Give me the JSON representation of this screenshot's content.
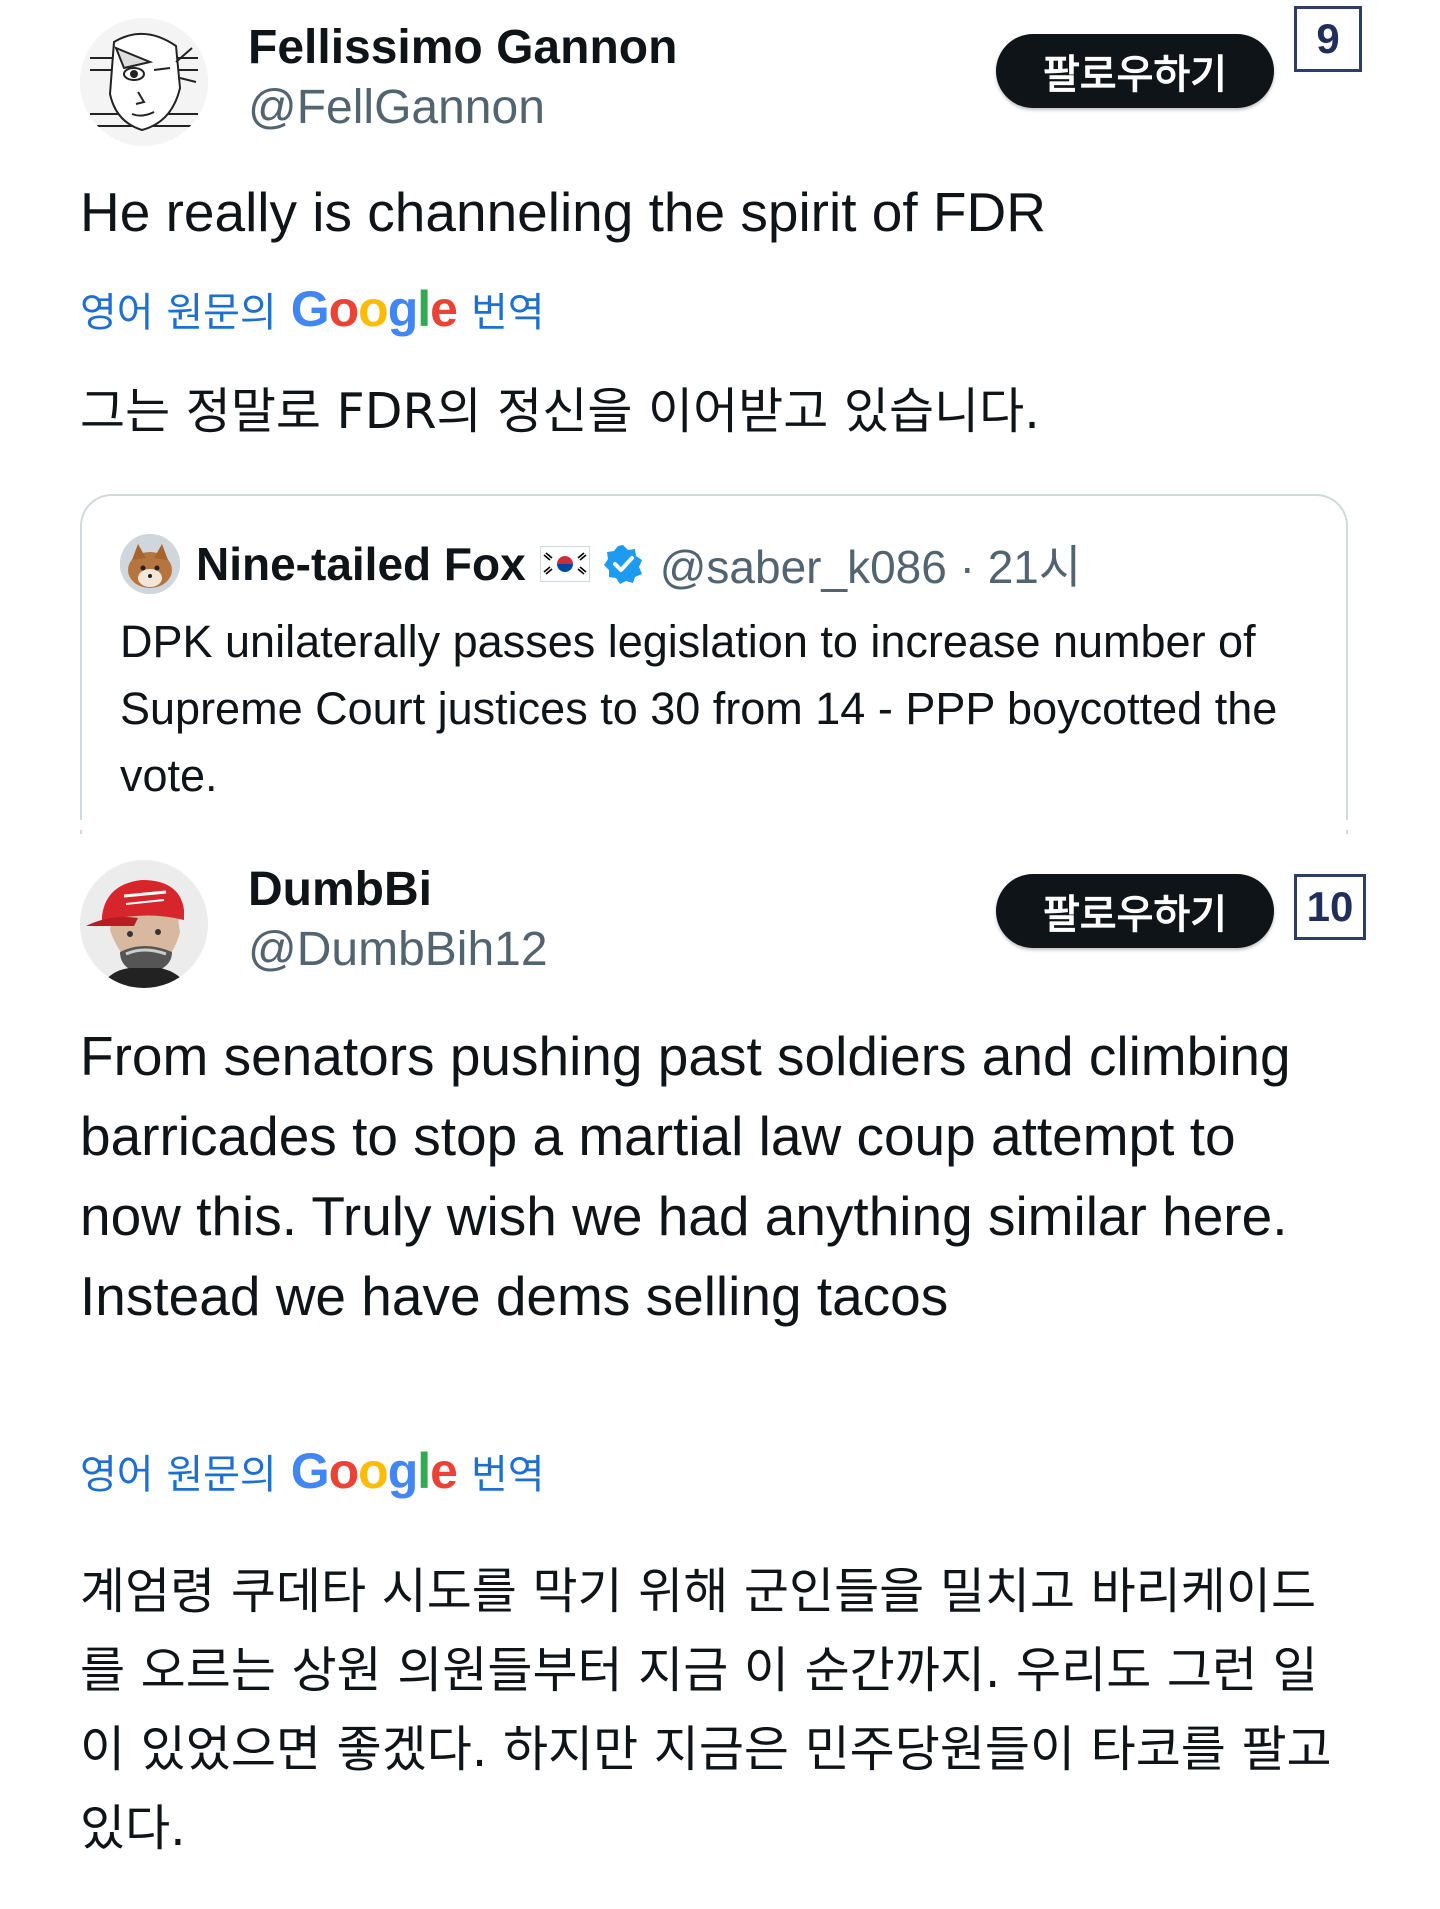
{
  "posts": [
    {
      "index_badge": "9",
      "author_name": "Fellissimo Gannon",
      "author_handle": "@FellGannon",
      "avatar_icon": "sketch-face-avatar-icon",
      "follow_label": "팔로우하기",
      "text": "He really is channeling the spirit of FDR",
      "translate_prefix": "영어 원문의",
      "translate_brand": "Google",
      "translate_suffix": "번역",
      "translation": "그는 정말로 FDR의 정신을 이어받고 있습니다.",
      "quote": {
        "author_name": "Nine-tailed Fox",
        "flag_icon": "south-korea-flag-icon",
        "verified_icon": "verified-badge-icon",
        "author_handle": "@saber_k086 · 21시",
        "text": "DPK unilaterally passes legislation to increase number of Supreme Court justices to 30 from 14 - PPP boycotted the vote."
      }
    },
    {
      "index_badge": "10",
      "author_name": "DumbBi",
      "author_handle": "@DumbBih12",
      "avatar_icon": "red-cap-avatar-icon",
      "follow_label": "팔로우하기",
      "text": "From senators pushing past soldiers and climbing barricades to stop a martial law coup attempt to now this. Truly wish we had anything similar here. Instead we have dems selling tacos",
      "translate_prefix": "영어 원문의",
      "translate_brand": "Google",
      "translate_suffix": "번역",
      "translation": "계엄령 쿠데타 시도를 막기 위해 군인들을 밀치고 바리케이드를 오르는 상원 의원들부터 지금 이 순간까지. 우리도 그런 일이 있었으면 좋겠다. 하지만 지금은 민주당원들이 타코를 팔고 있다."
    }
  ],
  "colors": {
    "text": "#0f1419",
    "secondary": "#536471",
    "translate_link": "#1d6fd1",
    "follow_button_bg": "#0f1419",
    "badge_border": "#2c3d6a",
    "verified_blue": "#1d9bf0"
  }
}
